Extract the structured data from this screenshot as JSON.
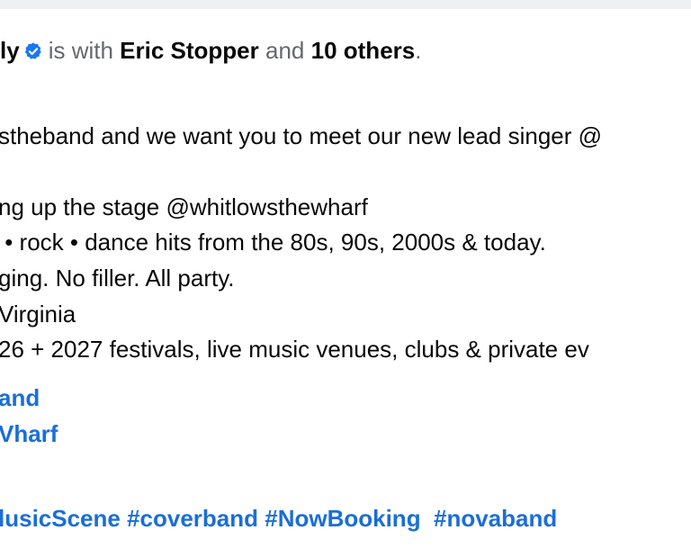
{
  "post": {
    "author_fragment": "ly",
    "with_text": "is with",
    "tagged_person": "Eric Stopper",
    "and_text": "and",
    "others_count": "10 others",
    "period": ".",
    "lines": [
      "stheband and we want you to meet our new lead singer @",
      "ng up the stage @whitlowsthewharf",
      " • rock • dance hits from the 80s, 90s, 2000s & today.",
      "ging. No filler. All party.",
      "Virginia",
      "26 + 2027 festivals, live music venues, clubs & private ev"
    ],
    "link_lines": [
      "and",
      "Vharf"
    ],
    "hashtags": "lusicScene #coverband #NowBooking  #novaband"
  },
  "colors": {
    "link": "#1a6ed8",
    "muted": "#65686c",
    "verified": "#1877f2"
  },
  "icons": {
    "verified": "verified-badge-icon"
  }
}
